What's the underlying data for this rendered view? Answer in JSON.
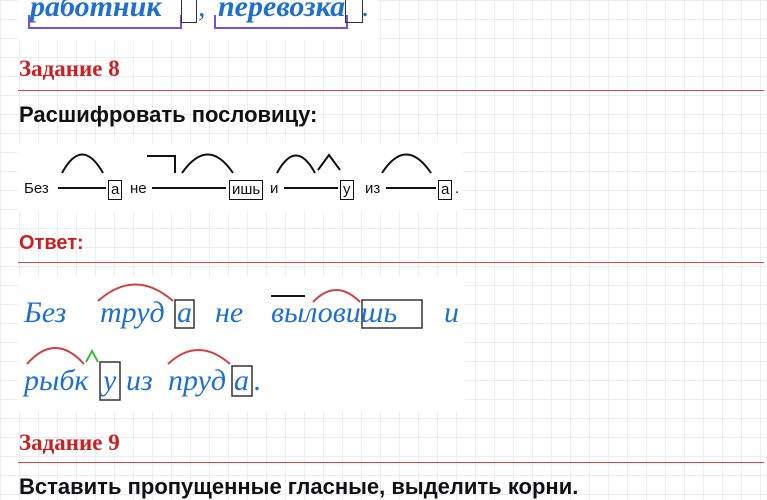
{
  "top": {
    "word1": "работник",
    "comma": ",",
    "word2": "перевозка",
    "period": "."
  },
  "task8": {
    "title": "Задание 8",
    "instruction": "Расшифровать пословицу:",
    "puzzle": {
      "w1": "Без",
      "end1": "а",
      "w2": "не",
      "end2": "ишь",
      "w3": "и",
      "end3": "у",
      "w4": "из",
      "end4": "а",
      "period": "."
    },
    "answer_label": "Ответ:",
    "answer": {
      "line1": [
        "Без",
        "труд",
        "а",
        "не",
        "выловишь",
        "и"
      ],
      "line2_words": [
        "рыбк",
        "у",
        "из",
        "пруд",
        "а",
        "."
      ]
    }
  },
  "task9": {
    "title": "Задание 9",
    "instruction": "Вставить пропущенные гласные, выделить корни."
  },
  "colors": {
    "red": "#cc1f1f",
    "blue": "#1e6fd0",
    "purple": "#7a4fd0",
    "green": "#3dbb3d"
  }
}
